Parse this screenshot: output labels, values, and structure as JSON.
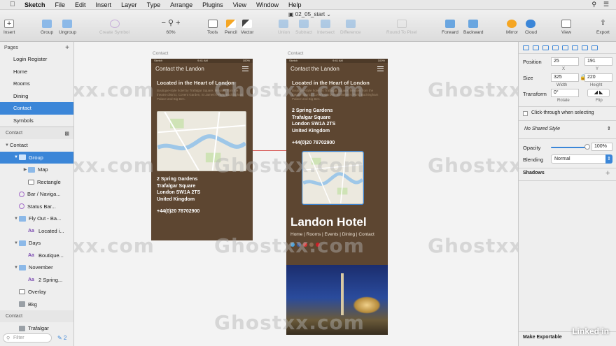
{
  "menubar": {
    "app": "Sketch",
    "items": [
      "File",
      "Edit",
      "Insert",
      "Layer",
      "Type",
      "Arrange",
      "Plugins",
      "View",
      "Window",
      "Help"
    ]
  },
  "document": {
    "title": "02_05_start"
  },
  "toolbar": {
    "insert": "Insert",
    "group": "Group",
    "ungroup": "Ungroup",
    "create_symbol": "Create Symbol",
    "zoom": "60%",
    "tools": "Tools",
    "pencil": "Pencil",
    "vector": "Vector",
    "union": "Union",
    "subtract": "Subtract",
    "intersect": "Intersect",
    "difference": "Difference",
    "round": "Round To Pixel",
    "forward": "Forward",
    "backward": "Backward",
    "mirror": "Mirror",
    "cloud": "Cloud",
    "view": "View",
    "export": "Export"
  },
  "pages": {
    "header": "Pages",
    "items": [
      "Login Register",
      "Home",
      "Rooms",
      "Dining",
      "Contact",
      "Symbols"
    ],
    "selected": 4
  },
  "layers": {
    "group_header": "Contact",
    "items": [
      {
        "label": "Contact",
        "depth": 0,
        "type": "board"
      },
      {
        "label": "Group",
        "depth": 1,
        "type": "folder",
        "selected": true
      },
      {
        "label": "Map",
        "depth": 2,
        "type": "folder"
      },
      {
        "label": "Rectangle",
        "depth": 2,
        "type": "rect"
      },
      {
        "label": "Bar / Naviga...",
        "depth": 1,
        "type": "symbol"
      },
      {
        "label": "Status Bar...",
        "depth": 1,
        "type": "symbol"
      },
      {
        "label": "Fly Out - Ba...",
        "depth": 1,
        "type": "folder"
      },
      {
        "label": "Located i...",
        "depth": 2,
        "type": "text"
      },
      {
        "label": "Days",
        "depth": 1,
        "type": "folder"
      },
      {
        "label": "Boutique...",
        "depth": 2,
        "type": "text"
      },
      {
        "label": "November",
        "depth": 1,
        "type": "folder"
      },
      {
        "label": "2 Spring...",
        "depth": 2,
        "type": "text"
      },
      {
        "label": "Overlay",
        "depth": 1,
        "type": "rect"
      },
      {
        "label": "Bkg",
        "depth": 1,
        "type": "image"
      }
    ],
    "group2_header": "Contact",
    "items2": [
      {
        "label": "Trafalgar",
        "depth": 1,
        "type": "image"
      }
    ],
    "filter_placeholder": "Filter"
  },
  "artboards": {
    "left": {
      "label": "Contact",
      "status_left": "Sketch",
      "status_time": "9:41 AM",
      "status_right": "100%",
      "nav_title": "Contact the Landon",
      "heading": "Located in the Heart of London",
      "blurb": "Boutique-style hotel by Trafalgar Square. Minutes from the theatre district, Covent Garden, St James's Park, Buckingham Palace and Big Ben.",
      "address": [
        "2 Spring Gardens",
        "Trafalgar Square",
        "London SW1A 2TS",
        "United Kingdom"
      ],
      "phone": "+44(0)20 78702900"
    },
    "right": {
      "label": "Contact",
      "status_left": "Sketch",
      "status_time": "9:41 AM",
      "status_right": "100%",
      "nav_title": "Contact the Landon",
      "heading": "Located in the Heart of London",
      "blurb": "Boutique-style hotel by Trafalgar Square. Minutes from the theatre district, Covent Garden, St James's Park, Buckingham Palace and Big Ben.",
      "address": [
        "2 Spring Gardens",
        "Trafalgar Square",
        "London SW1A 2TS",
        "United Kingdom"
      ],
      "phone": "+44(0)20 78702900",
      "hotel": "Landon Hotel",
      "hotel_nav": "Home  |  Rooms  |  Events  |  Dining  |  Contact"
    }
  },
  "inspector": {
    "position_label": "Position",
    "x": "25",
    "y": "191",
    "x_label": "X",
    "y_label": "Y",
    "size_label": "Size",
    "width": "325",
    "height": "220",
    "width_label": "Width",
    "height_label": "Height",
    "transform_label": "Transform",
    "rotate": "0°",
    "rotate_label": "Rotate",
    "flip_label": "Flip",
    "clickthrough": "Click-through when selecting",
    "shared_style": "No Shared Style",
    "opacity_label": "Opacity",
    "opacity_value": "100%",
    "opacity": 1.0,
    "blending_label": "Blending",
    "blending": "Normal",
    "shadows": "Shadows",
    "export": "Make Exportable"
  },
  "watermark": "Ghostxx.com",
  "brand": "Linked in",
  "colors": {
    "accent": "#3b86d8",
    "board": "#5d4631"
  }
}
